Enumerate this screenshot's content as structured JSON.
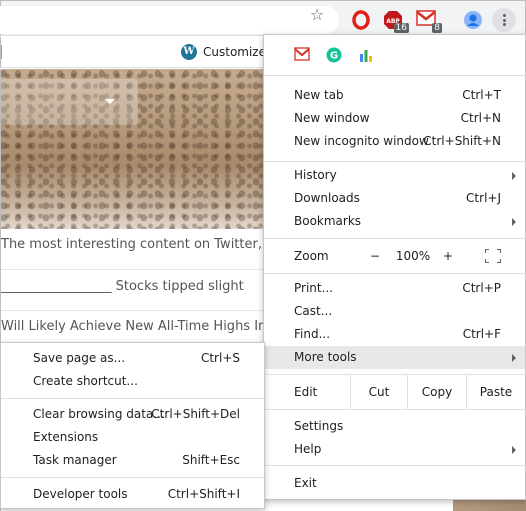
{
  "toolbar": {
    "icons": [
      "star-icon",
      "opera-icon",
      "adblock-icon",
      "gmail-icon",
      "profile-icon",
      "kebab-menu-icon"
    ],
    "adblock_badge": "16",
    "gmail_badge": "8",
    "colors": {
      "toolbar_bg": "#f1f3f4",
      "opera_red": "#e0201b",
      "adblock_red": "#c2171a",
      "gmail_red": "#d93025"
    }
  },
  "bookmarks": {
    "customize_label": "Customize"
  },
  "page": {
    "headlines": [
      "The most interesting content on Twitter, t",
      "_________________ Stocks tipped slight",
      "Will Likely Achieve New All-Time Highs In"
    ]
  },
  "menu": {
    "extension_icons": [
      "gmail-icon",
      "grammarly-icon",
      "chart-icon"
    ],
    "new_tab": {
      "label": "New tab",
      "shortcut": "Ctrl+T"
    },
    "new_window": {
      "label": "New window",
      "shortcut": "Ctrl+N"
    },
    "new_incognito": {
      "label": "New incognito window",
      "shortcut": "Ctrl+Shift+N"
    },
    "history": {
      "label": "History"
    },
    "downloads": {
      "label": "Downloads",
      "shortcut": "Ctrl+J"
    },
    "bookmarks": {
      "label": "Bookmarks"
    },
    "zoom": {
      "label": "Zoom",
      "minus": "−",
      "value": "100%",
      "plus": "+"
    },
    "print": {
      "label": "Print...",
      "shortcut": "Ctrl+P"
    },
    "cast": {
      "label": "Cast..."
    },
    "find": {
      "label": "Find...",
      "shortcut": "Ctrl+F"
    },
    "more_tools": {
      "label": "More tools"
    },
    "edit": {
      "label": "Edit",
      "cut": "Cut",
      "copy": "Copy",
      "paste": "Paste"
    },
    "settings": {
      "label": "Settings"
    },
    "help": {
      "label": "Help"
    },
    "exit": {
      "label": "Exit"
    }
  },
  "submenu": {
    "save_page": {
      "label": "Save page as...",
      "shortcut": "Ctrl+S"
    },
    "create_shortcut": {
      "label": "Create shortcut..."
    },
    "clear_browsing": {
      "label": "Clear browsing data...",
      "shortcut": "Ctrl+Shift+Del"
    },
    "extensions": {
      "label": "Extensions"
    },
    "task_manager": {
      "label": "Task manager",
      "shortcut": "Shift+Esc"
    },
    "developer_tools": {
      "label": "Developer tools",
      "shortcut": "Ctrl+Shift+I"
    }
  }
}
